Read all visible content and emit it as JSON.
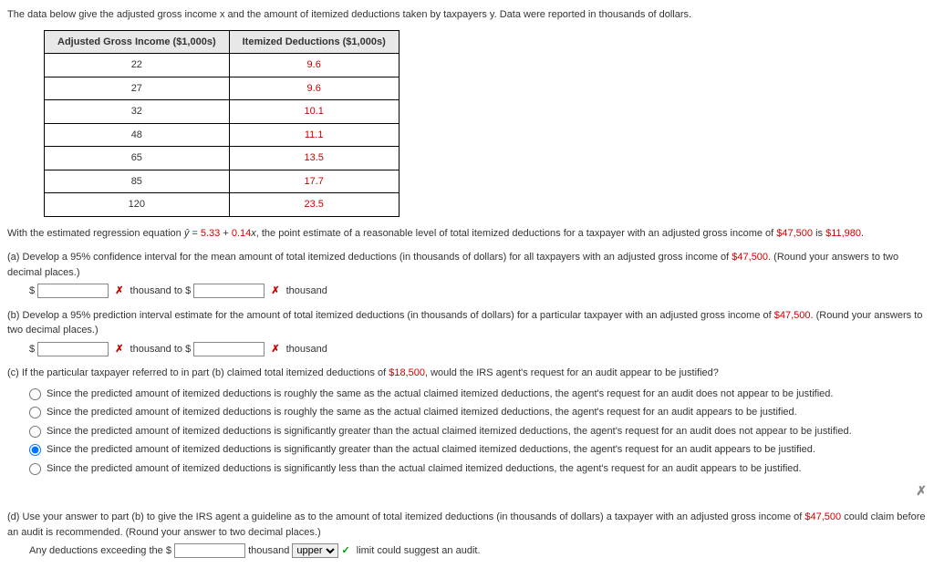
{
  "intro": "The data below give the adjusted gross income x and the amount of itemized deductions taken by taxpayers y. Data were reported in thousands of dollars.",
  "table": {
    "head_income": "Adjusted Gross Income ($1,000s)",
    "head_deduct": "Itemized Deductions ($1,000s)",
    "rows": [
      {
        "x": "22",
        "y": "9.6"
      },
      {
        "x": "27",
        "y": "9.6"
      },
      {
        "x": "32",
        "y": "10.1"
      },
      {
        "x": "48",
        "y": "11.1"
      },
      {
        "x": "65",
        "y": "13.5"
      },
      {
        "x": "85",
        "y": "17.7"
      },
      {
        "x": "120",
        "y": "23.5"
      }
    ]
  },
  "regression": {
    "prefix": "With the estimated regression equation ",
    "yhat": "ŷ",
    "eq_mid": " = ",
    "a": "5.33",
    "plus": " + ",
    "b": "0.14",
    "xlab": "x",
    "after": ", the point estimate of a reasonable level of total itemized deductions for a taxpayer with an adjusted gross income of ",
    "val1": "$47,500",
    "is": " is ",
    "val2": "$11,980",
    "period": "."
  },
  "a": {
    "label": "(a)",
    "text1": "Develop a 95% confidence interval for the mean amount of total itemized deductions (in thousands of dollars) for all taxpayers with an adjusted gross income of ",
    "val": "$47,500",
    "text2": ". (Round your answers to two decimal places.)",
    "dollar": "$",
    "thousand_to": " thousand to $",
    "thousand": " thousand",
    "wrong": "✗"
  },
  "b": {
    "label": "(b)",
    "text1": "Develop a 95% prediction interval estimate for the amount of total itemized deductions (in thousands of dollars) for a particular taxpayer with an adjusted gross income of ",
    "val": "$47,500",
    "text2": ". (Round your answers to two decimal places.)",
    "dollar": "$",
    "thousand_to": " thousand to $",
    "thousand": " thousand",
    "wrong": "✗"
  },
  "c": {
    "label": "(c)",
    "question": "If the particular taxpayer referred to in part (b) claimed total itemized deductions of ",
    "val": "$18,500",
    "question2": ", would the IRS agent's request for an audit appear to be justified?",
    "opt1": "Since the predicted amount of itemized deductions is roughly the same as the actual claimed itemized deductions, the agent's request for an audit does not appear to be justified.",
    "opt2": "Since the predicted amount of itemized deductions is roughly the same as the actual claimed itemized deductions, the agent's request for an audit appears to be justified.",
    "opt3": "Since the predicted amount of itemized deductions is significantly greater than the actual claimed itemized deductions, the agent's request for an audit does not appear to be justified.",
    "opt4": "Since the predicted amount of itemized deductions is significantly greater than the actual claimed itemized deductions, the agent's request for an audit appears to be justified.",
    "opt5": "Since the predicted amount of itemized deductions is significantly less than the actual claimed itemized deductions, the agent's request for an audit appears to be justified.",
    "fb": "✗"
  },
  "d": {
    "label": "(d)",
    "text1": "Use your answer to part (b) to give the IRS agent a guideline as to the amount of total itemized deductions (in thousands of dollars) a taxpayer with an adjusted gross income of ",
    "val": "$47,500",
    "text2": " could claim before an audit is recommended. (Round your answer to two decimal places.)",
    "ans1": "Any deductions exceeding the $",
    "ans2": " thousand ",
    "selected": "upper",
    "check": "✓",
    "ans3": " limit could suggest an audit."
  }
}
